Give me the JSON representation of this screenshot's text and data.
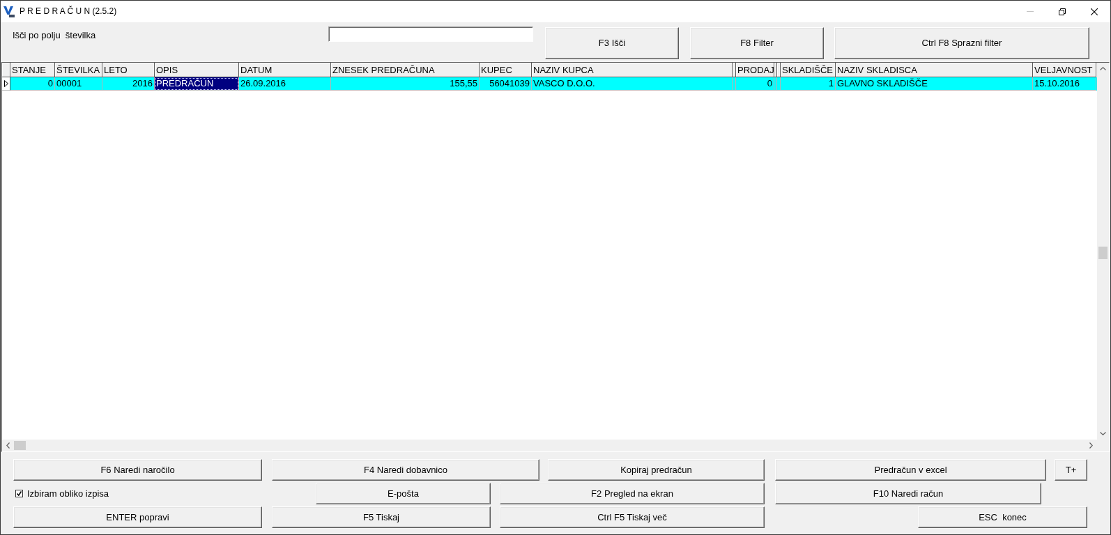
{
  "window": {
    "title": "P R E D R A Č U N (2.5.2)",
    "controls": [
      {
        "kind": "minimize",
        "disabled": true
      },
      {
        "kind": "restore",
        "disabled": false
      },
      {
        "kind": "close",
        "disabled": false
      }
    ]
  },
  "search": {
    "label": "Išči po polju  številka"
  },
  "top_buttons": [
    {
      "label": "F3 Išči"
    },
    {
      "label": "F8 Filter"
    },
    {
      "label": "Ctrl F8 Sprazni filter"
    }
  ],
  "table": {
    "columns": [
      {
        "label": "STANJE",
        "kind": "number"
      },
      {
        "label": "ŠTEVILKA",
        "kind": "text"
      },
      {
        "label": "LETO",
        "kind": "number"
      },
      {
        "label": "OPIS",
        "kind": "text"
      },
      {
        "label": "DATUM",
        "kind": "text"
      },
      {
        "label": "ZNESEK PREDRAČUNA",
        "kind": "number"
      },
      {
        "label": "KUPEC",
        "kind": "number"
      },
      {
        "label": "NAZIV KUPCA",
        "kind": "text"
      },
      {
        "kind": "collapsed"
      },
      {
        "label": "PRODAJ",
        "kind": "number"
      },
      {
        "kind": "collapsed"
      },
      {
        "kind": "collapsed"
      },
      {
        "label": "SKLADIŠČE",
        "kind": "number"
      },
      {
        "label": "NAZIV SKLADISCA",
        "kind": "text"
      },
      {
        "label": "VELJAVNOST",
        "kind": "text"
      }
    ],
    "rows": [
      {
        "selected": true,
        "cells": [
          {
            "text": "0",
            "selected": false
          },
          {
            "text": "00001",
            "selected": false
          },
          {
            "text": "2016",
            "selected": false
          },
          {
            "text": "PREDRAČUN",
            "selected": true
          },
          {
            "text": "26.09.2016",
            "selected": false
          },
          {
            "text": "155,55",
            "selected": false
          },
          {
            "text": "56041039",
            "selected": false
          },
          {
            "text": "VASCO D.O.O.",
            "selected": false
          },
          {
            "selected": false
          },
          {
            "text": "0",
            "selected": false
          },
          {
            "selected": false
          },
          {
            "selected": false
          },
          {
            "text": "1",
            "selected": false
          },
          {
            "text": "GLAVNO SKLADIŠČE",
            "selected": false
          },
          {
            "text": "15.10.2016",
            "selected": false
          }
        ]
      }
    ]
  },
  "bottom_controls": [
    {
      "kind": "button",
      "label": "F6 Naredi naročilo"
    },
    {
      "kind": "button",
      "label": "F4 Naredi dobavnico"
    },
    {
      "kind": "button",
      "label": "Kopiraj predračun"
    },
    {
      "kind": "button",
      "label": "Predračun v excel"
    },
    {
      "kind": "button",
      "label": "T+"
    },
    {
      "kind": "checkbox",
      "label": "Izbiram obliko izpisa",
      "checked": true
    },
    {
      "kind": "button",
      "label": "E-pošta"
    },
    {
      "kind": "button",
      "label": "F2 Pregled na ekran"
    },
    {
      "kind": "button",
      "label": "F10 Naredi račun"
    },
    {
      "kind": "button",
      "label": "ENTER popravi"
    },
    {
      "kind": "button",
      "label": "F5 Tiskaj"
    },
    {
      "kind": "button",
      "label": "Ctrl F5 Tiskaj več"
    },
    {
      "kind": "button",
      "label": "ESC  konec"
    }
  ]
}
